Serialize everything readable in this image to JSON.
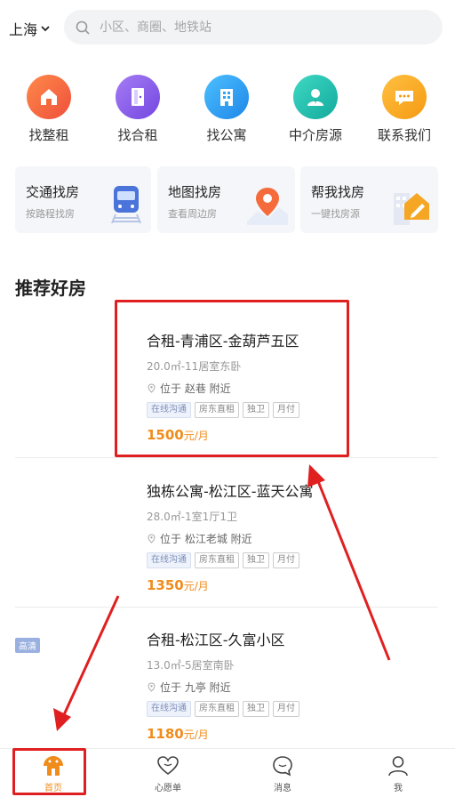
{
  "header": {
    "city": "上海",
    "search_placeholder": "小区、商圈、地铁站"
  },
  "categories": [
    {
      "label": "找整租",
      "icon": "house-icon",
      "color": "#f26a3a"
    },
    {
      "label": "找合租",
      "icon": "door-icon",
      "color": "#8b63e8"
    },
    {
      "label": "找公寓",
      "icon": "building-icon",
      "color": "#2fa6f4"
    },
    {
      "label": "中介房源",
      "icon": "agent-icon",
      "color": "#23c2b3"
    },
    {
      "label": "联系我们",
      "icon": "chat-icon",
      "color": "#f7a21c"
    }
  ],
  "feature_cards": [
    {
      "title": "交通找房",
      "subtitle": "按路程找房",
      "icon": "train-icon"
    },
    {
      "title": "地图找房",
      "subtitle": "查看周边房",
      "icon": "map-pin-icon"
    },
    {
      "title": "帮我找房",
      "subtitle": "一键找房源",
      "icon": "edit-icon"
    }
  ],
  "section": {
    "title": "推荐好房"
  },
  "listings": [
    {
      "name": "合租-青浦区-金葫芦五区",
      "spec": "20.0㎡-11居室东卧",
      "location": "位于 赵巷 附近",
      "tags": [
        "在线沟通",
        "房东直租",
        "独卫",
        "月付"
      ],
      "price": "1500",
      "unit": "元/月",
      "badge": ""
    },
    {
      "name": "独栋公寓-松江区-蓝天公寓",
      "spec": "28.0㎡-1室1厅1卫",
      "location": "位于 松江老城 附近",
      "tags": [
        "在线沟通",
        "房东直租",
        "独卫",
        "月付"
      ],
      "price": "1350",
      "unit": "元/月",
      "badge": ""
    },
    {
      "name": "合租-松江区-久富小区",
      "spec": "13.0㎡-5居室南卧",
      "location": "位于 九亭 附近",
      "tags": [
        "在线沟通",
        "房东直租",
        "独卫",
        "月付"
      ],
      "price": "1180",
      "unit": "元/月",
      "badge": "高清"
    }
  ],
  "bottom_nav": [
    {
      "label": "首页",
      "icon": "home-icon",
      "active": true
    },
    {
      "label": "心愿单",
      "icon": "heart-icon",
      "active": false
    },
    {
      "label": "消息",
      "icon": "message-icon",
      "active": false
    },
    {
      "label": "我",
      "icon": "user-icon",
      "active": false
    }
  ],
  "colors": {
    "accent": "#f08c1c",
    "annotation": "#e02020",
    "search_bg": "#f2f3f5"
  }
}
